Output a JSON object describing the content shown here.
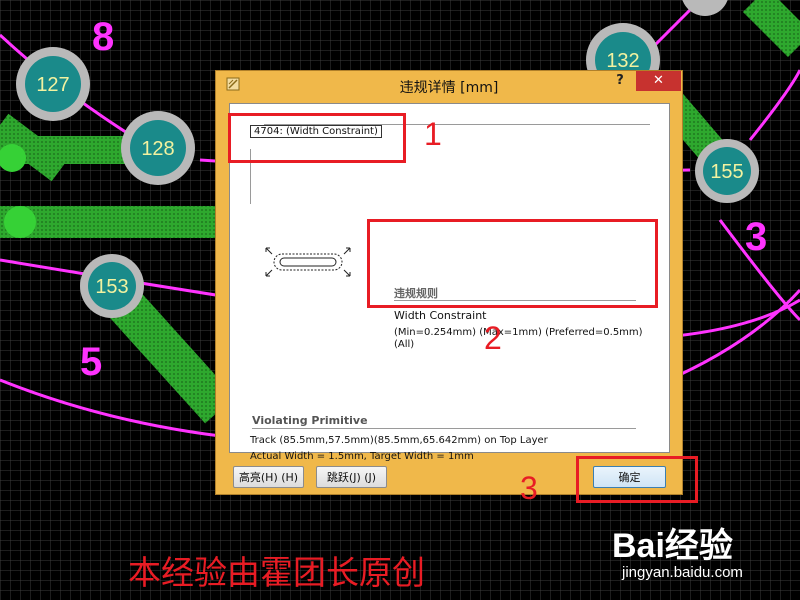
{
  "pcb": {
    "pads": [
      {
        "label": "127"
      },
      {
        "label": "128"
      },
      {
        "label": "132"
      },
      {
        "label": "155"
      },
      {
        "label": "153"
      }
    ],
    "net_numbers": [
      "8",
      "3",
      "5"
    ]
  },
  "dialog": {
    "title": "违规详情 [mm]",
    "help_label": "?",
    "close_label": "✕",
    "violation_id": "4704:  (Width Constraint)",
    "rule": {
      "title": "违规规则",
      "name": "Width Constraint",
      "params": "(Min=0.254mm) (Max=1mm) (Preferred=0.5mm)",
      "scope": "(All)"
    },
    "primitive": {
      "title": "Violating Primitive",
      "track": "Track (85.5mm,57.5mm)(85.5mm,65.642mm) on Top Layer",
      "width": "Actual Width = 1.5mm, Target Width = 1mm"
    },
    "buttons": {
      "highlight": "高亮(H) (H)",
      "jump": "跳跃(J) (J)",
      "ok": "确定"
    }
  },
  "annotations": {
    "labels": [
      "1",
      "2",
      "3"
    ]
  },
  "credit": "本经验由霍团长原创",
  "watermark": {
    "brand": "Bai经验",
    "url": "jingyan.baidu.com"
  },
  "colors": {
    "track_green": "#2ea82e",
    "pad_teal": "#1a8a8a",
    "pad_ring": "#b9b9b9",
    "net_pink": "#ff33ff",
    "annotation_red": "#e81c24"
  }
}
